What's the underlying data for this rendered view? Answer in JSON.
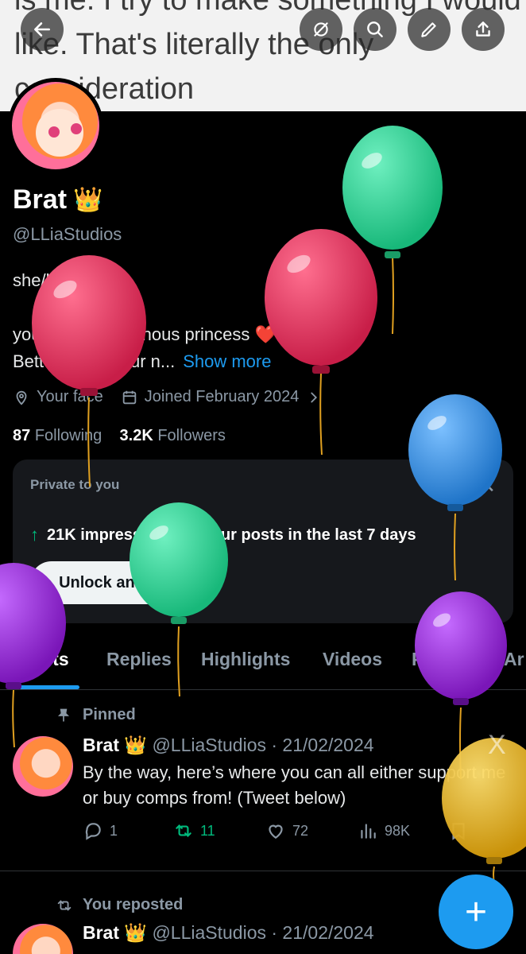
{
  "banner": {
    "text": "is me. I try to make something I would like. That's literally the only consideration"
  },
  "header_buttons": [
    {
      "icon": "back-arrow-icon"
    },
    {
      "icon": "no-location-icon"
    },
    {
      "icon": "search-icon"
    },
    {
      "icon": "edit-icon"
    },
    {
      "icon": "share-icon"
    }
  ],
  "profile": {
    "name": "Brat",
    "crown": "👑",
    "handle": "@LLiaStudios",
    "bio_line1": "she/her 🔞",
    "bio_line2": "your bratty poisonous princess ❤️",
    "bio_line3": "Better cover your n...",
    "show_more": "Show more",
    "location": "Your face",
    "joined": "Joined February 2024",
    "following_count": "87",
    "following_label": "Following",
    "followers_count": "3.2K",
    "followers_label": "Followers"
  },
  "analytics_card": {
    "private_label": "Private to you",
    "close": "✕",
    "stat_arrow": "↑",
    "stat_text": "21K impressions on your posts in the last 7 days",
    "button": "Unlock analytics"
  },
  "tabs": [
    "Posts",
    "Replies",
    "Highlights",
    "Videos",
    "Photos",
    "Ar"
  ],
  "posts": [
    {
      "context": "Pinned",
      "author": "Brat",
      "crown": "👑",
      "handle_date": "@LLiaStudios · 21/02/2024",
      "text": "By the way, here’s where you can all either support me or buy comps from! (Tweet below)",
      "replies": "1",
      "reposts": "11",
      "likes": "72",
      "views": "98K"
    },
    {
      "context": "You reposted",
      "author": "Brat",
      "crown": "👑",
      "handle_date": "@LLiaStudios · 21/02/2024"
    }
  ],
  "fab": "+",
  "overlay_mark": "X",
  "colors": {
    "accent": "#1d9bf0",
    "repost": "#00ba7c",
    "balloon_green": "#2fd69a",
    "balloon_red": "#e0365f",
    "balloon_blue": "#3a92e6",
    "balloon_purple": "#9a2fd6",
    "balloon_yellow": "#e6b820"
  }
}
